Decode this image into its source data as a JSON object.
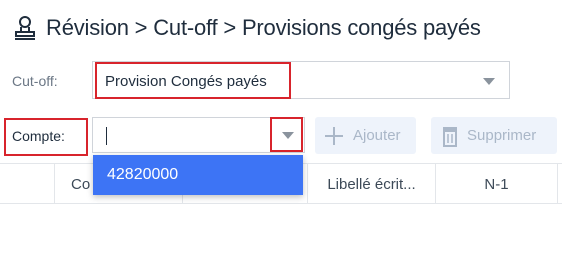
{
  "header": {
    "icon": "stamp-icon",
    "title": "Révision > Cut-off > Provisions congés payés"
  },
  "cutoff": {
    "label": "Cut-off:",
    "value": "Provision Congés payés",
    "caret_icon": "caret-down-icon"
  },
  "compte": {
    "label": "Compte:",
    "value": "",
    "caret_icon": "caret-down-icon"
  },
  "toolbar": {
    "add_label": "Ajouter",
    "add_icon": "plus-icon",
    "delete_label": "Supprimer",
    "delete_icon": "trash-icon"
  },
  "dropdown": {
    "options": [
      "42820000"
    ]
  },
  "table": {
    "columns": [
      "",
      "Co",
      "",
      "Libellé écrit...",
      "N-1"
    ]
  },
  "colors": {
    "highlight": "#d8242c",
    "accent": "#3d74f5",
    "disabled_button_bg": "#eef3fb",
    "disabled_text": "#aab7c8"
  }
}
